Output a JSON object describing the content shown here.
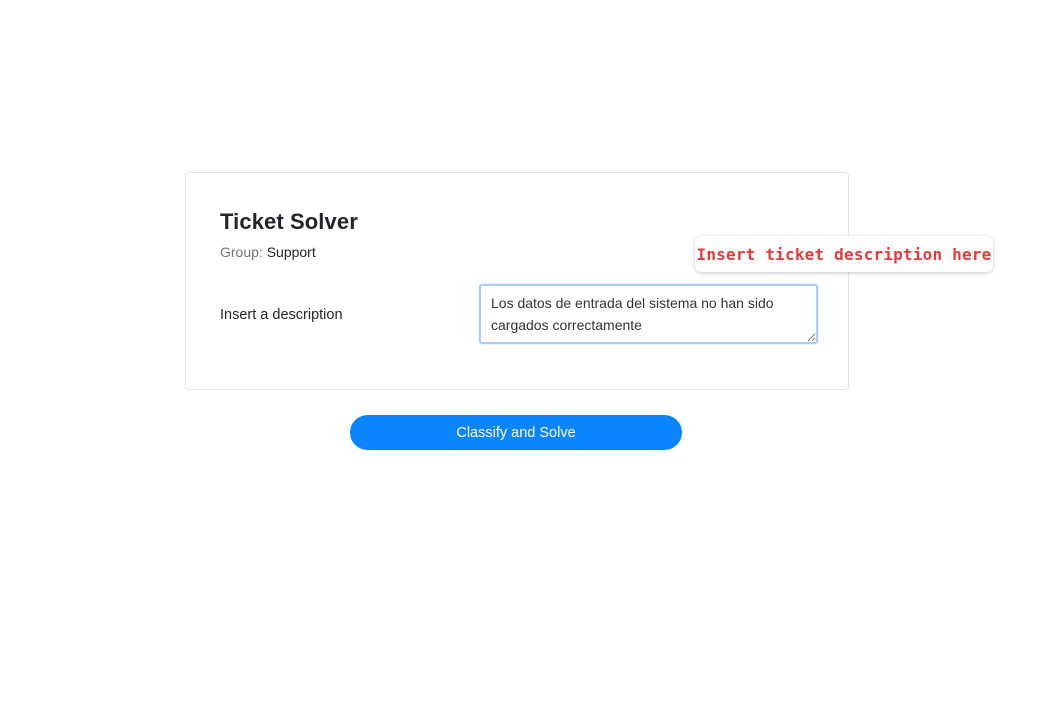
{
  "card": {
    "title": "Ticket Solver",
    "group_label": "Group:",
    "group_value": "Support",
    "description_label": "Insert a description",
    "description_value": "Los datos de entrada del sistema no han sido cargados correctamente"
  },
  "actions": {
    "submit_label": "Classify and Solve"
  },
  "annotation": {
    "text": "Insert ticket description here"
  },
  "colors": {
    "accent": "#0a84ff",
    "annotation_text": "#e23b3b",
    "input_focus_border": "#a9cdf3"
  }
}
